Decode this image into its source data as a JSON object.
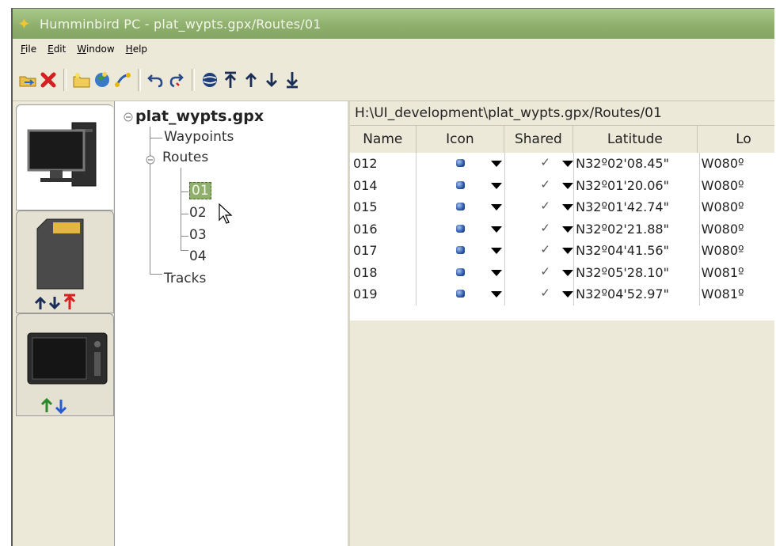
{
  "window": {
    "title": "Humminbird PC - plat_wypts.gpx/Routes/01"
  },
  "menu": [
    "File",
    "Edit",
    "Window",
    "Help"
  ],
  "toolbar": {
    "icons": [
      "open-folder-icon",
      "delete-icon",
      "new-folder-icon",
      "globe-icon",
      "route-icon",
      "undo-icon",
      "redo-icon",
      "sphere-icon",
      "move-top-icon",
      "move-up-icon",
      "move-down-icon",
      "move-bottom-icon"
    ]
  },
  "tree": {
    "root": "plat_wypts.gpx",
    "nodes": [
      "Waypoints",
      "Routes",
      "Tracks"
    ],
    "routes": [
      "01",
      "02",
      "03",
      "04"
    ],
    "selected": "01"
  },
  "path": "H:\\UI_development\\plat_wypts.gpx/Routes/01",
  "table": {
    "headers": [
      "Name",
      "Icon",
      "Shared",
      "Latitude",
      "Lo"
    ],
    "rows": [
      {
        "name": "012",
        "lat": "N32º02'08.45\"",
        "lon": "W080º"
      },
      {
        "name": "014",
        "lat": "N32º01'20.06\"",
        "lon": "W080º"
      },
      {
        "name": "015",
        "lat": "N32º01'42.74\"",
        "lon": "W080º"
      },
      {
        "name": "016",
        "lat": "N32º02'21.88\"",
        "lon": "W080º"
      },
      {
        "name": "017",
        "lat": "N32º04'41.56\"",
        "lon": "W080º"
      },
      {
        "name": "018",
        "lat": "N32º05'28.10\"",
        "lon": "W081º"
      },
      {
        "name": "019",
        "lat": "N32º04'52.97\"",
        "lon": "W081º"
      }
    ]
  },
  "colors": {
    "titlebar": "#8fb06d",
    "selection": "#8fb06d",
    "chrome": "#ece9d8"
  }
}
